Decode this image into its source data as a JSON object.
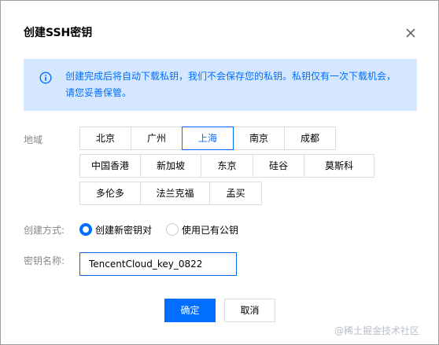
{
  "dialog": {
    "title": "创建SSH密钥",
    "close_icon": "close-icon"
  },
  "notice": {
    "icon": "info-circle-icon",
    "text": "创建完成后将自动下载私钥，我们不会保存您的私钥。私钥仅有一次下载机会，请您妥善保管。"
  },
  "region": {
    "label": "地域",
    "selected": "上海",
    "rows": [
      [
        "北京",
        "广州",
        "上海",
        "南京",
        "成都"
      ],
      [
        "中国香港",
        "新加坡",
        "东京",
        "硅谷",
        "莫斯科"
      ],
      [
        "多伦多",
        "法兰克福",
        "孟买"
      ]
    ]
  },
  "create_method": {
    "label": "创建方式:",
    "options": [
      {
        "label": "创建新密钥对",
        "checked": true
      },
      {
        "label": "使用已有公钥",
        "checked": false
      }
    ]
  },
  "key_name": {
    "label": "密钥名称:",
    "value": "TencentCloud_key_0822"
  },
  "buttons": {
    "confirm": "确定",
    "cancel": "取消"
  },
  "watermark": "@稀土掘金技术社区",
  "colors": {
    "accent": "#006eff",
    "notice_bg": "#d5e7fe",
    "label": "#888888",
    "border": "#dddddd"
  }
}
